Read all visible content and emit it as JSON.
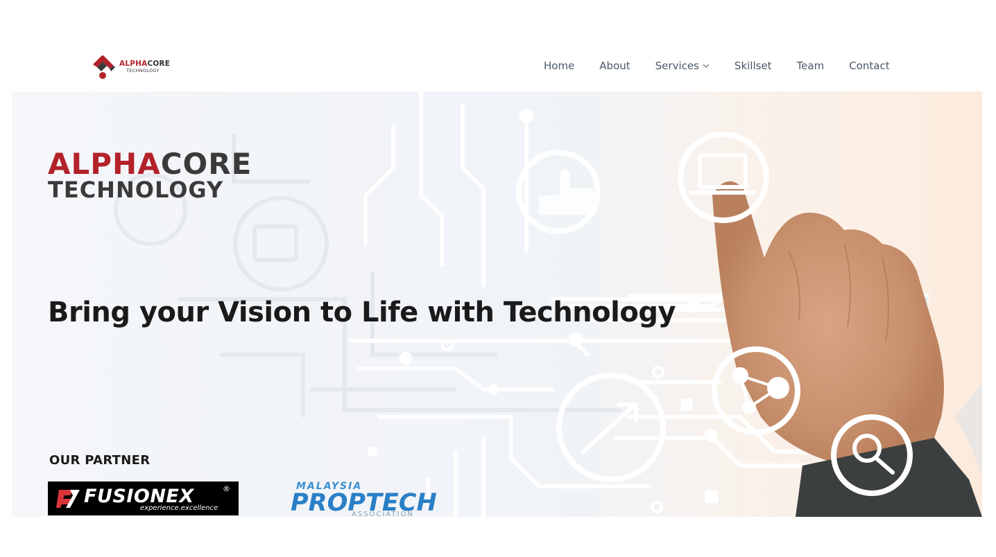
{
  "header": {
    "logo": {
      "word_red": "ALPHA",
      "word_dark": "CORE",
      "sub": "TECHNOLOGY"
    },
    "nav": [
      {
        "label": "Home"
      },
      {
        "label": "About"
      },
      {
        "label": "Services",
        "has_dropdown": true
      },
      {
        "label": "Skillset"
      },
      {
        "label": "Team"
      },
      {
        "label": "Contact"
      }
    ]
  },
  "hero": {
    "brand": {
      "word_red": "ALPHA",
      "word_dark": "CORE",
      "sub": "TECHNOLOGY"
    },
    "tagline": "Bring your Vision to Life with Technology",
    "partners_title": "OUR PARTNER",
    "partners": [
      {
        "name": "FUSIONEX",
        "reg": "®",
        "tagline": "experience.excellence"
      },
      {
        "name_top": "MALAYSIA",
        "name": "PROPTECH",
        "name_bottom": "ASSOCIATION"
      }
    ]
  },
  "colors": {
    "brand_red": "#b3222a",
    "brand_dark": "#3a3a3a",
    "nav_text": "#4a5868",
    "proptech_blue": "#2a7fc6"
  },
  "icons": [
    "alphacore-logo-icon",
    "chevron-down-icon",
    "fusionex-mark-icon",
    "laptop-icon",
    "thumbs-up-icon",
    "trend-arrow-icon",
    "network-icon",
    "magnifier-icon"
  ]
}
